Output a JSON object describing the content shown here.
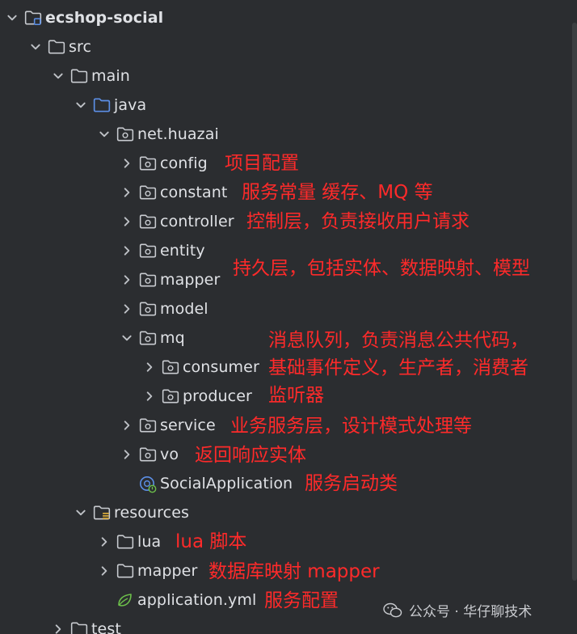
{
  "tree": {
    "root": "ecshop-social",
    "src": "src",
    "main": "main",
    "java": "java",
    "package": "net.huazai",
    "config": "config",
    "constant": "constant",
    "controller": "controller",
    "entity": "entity",
    "mapper": "mapper",
    "model": "model",
    "mq": "mq",
    "consumer": "consumer",
    "producer": "producer",
    "service": "service",
    "vo": "vo",
    "app_class": "SocialApplication",
    "resources": "resources",
    "lua": "lua",
    "res_mapper": "mapper",
    "yml": "application.yml",
    "test": "test"
  },
  "annotations": {
    "config": "项目配置",
    "constant": "服务常量 缓存、MQ 等",
    "controller": "控制层，负责接收用户请求",
    "entity_mapper_model": "持久层，包括实体、数据映射、模型",
    "mq_line1": "消息队列，负责消息公共代码，",
    "mq_line2": "基础事件定义，生产者，消费者",
    "mq_line3": "监听器",
    "service": "业务服务层，设计模式处理等",
    "vo": "返回响应实体",
    "app": "服务启动类",
    "lua": "lua 脚本",
    "res_mapper": "数据库映射 mapper",
    "yml": "服务配置"
  },
  "watermark": "公众号 · 华仔聊技术",
  "colors": {
    "background": "#2b2d30",
    "text": "#dfe1e5",
    "annotation": "#ff2a2a",
    "folder_outline": "#c9ccd1",
    "source_folder": "#5c8fe6",
    "spring_green": "#6cbf4a"
  }
}
